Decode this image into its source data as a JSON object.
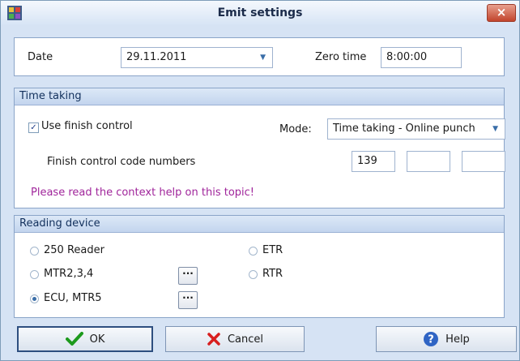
{
  "window": {
    "title": "Emit settings",
    "close_label": "×"
  },
  "header": {
    "date_label": "Date",
    "date_value": "29.11.2011",
    "zero_time_label": "Zero time",
    "zero_time_value": "8:00:00"
  },
  "time_taking": {
    "title": "Time taking",
    "use_finish_label": "Use finish control",
    "use_finish_checked": true,
    "mode_label": "Mode:",
    "mode_value": "Time taking - Online punch",
    "finish_codes_label": "Finish control code numbers",
    "codes": [
      "139",
      "",
      ""
    ],
    "help_note": "Please read the context help on this topic!"
  },
  "reading_device": {
    "title": "Reading device",
    "options": [
      {
        "label": "250 Reader",
        "checked": false
      },
      {
        "label": "MTR2,3,4",
        "checked": false
      },
      {
        "label": "ECU, MTR5",
        "checked": true
      },
      {
        "label": "ETR",
        "checked": false
      },
      {
        "label": "RTR",
        "checked": false
      }
    ],
    "dots_label": "···"
  },
  "buttons": {
    "ok": "OK",
    "cancel": "Cancel",
    "help": "Help"
  },
  "colors": {
    "help_note": "#a0259b",
    "ok_check": "#1d9a1d",
    "cancel_x": "#d81f1f",
    "title_bg": "#d7e4f5"
  },
  "icons": [
    "app-icon",
    "close-icon",
    "check-icon",
    "dropdown-arrow-icon",
    "ok-check-icon",
    "cancel-x-icon",
    "help-icon"
  ]
}
